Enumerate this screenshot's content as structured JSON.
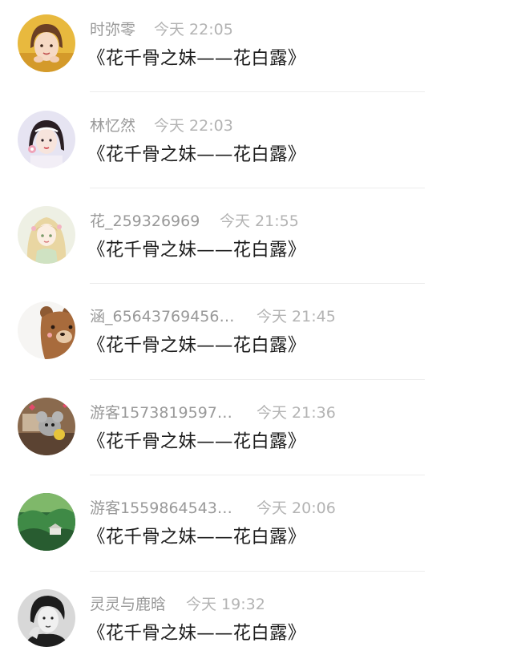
{
  "comments": [
    {
      "user": "时弥零",
      "time": "今天 22:05",
      "text": "《花千骨之妹——花白露》",
      "avatar": "avatar-girl-yellow"
    },
    {
      "user": "林忆然",
      "time": "今天 22:03",
      "text": "《花千骨之妹——花白露》",
      "avatar": "avatar-girl-flower"
    },
    {
      "user": "花_259326969",
      "time": "今天 21:55",
      "text": "《花千骨之妹——花白露》",
      "avatar": "avatar-anime-girl"
    },
    {
      "user": "涵_65643769456…",
      "time": "今天 21:45",
      "text": "《花千骨之妹——花白露》",
      "avatar": "avatar-bear"
    },
    {
      "user": "游客1573819597…",
      "time": "今天 21:36",
      "text": "《花千骨之妹——花白露》",
      "avatar": "avatar-cartoon-mouse"
    },
    {
      "user": "游客1559864543…",
      "time": "今天 20:06",
      "text": "《花千骨之妹——花白露》",
      "avatar": "avatar-forest"
    },
    {
      "user": "灵灵与鹿晗",
      "time": "今天 19:32",
      "text": "《花千骨之妹——花白露》",
      "avatar": "avatar-man-bw"
    }
  ]
}
